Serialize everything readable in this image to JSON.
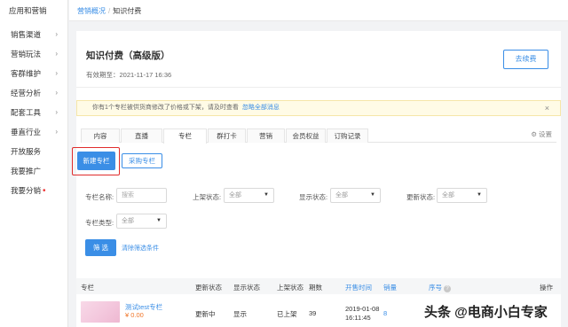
{
  "sidebar": {
    "header": "应用和营销",
    "items": [
      {
        "label": "销售渠道",
        "chevron": true,
        "dot": false
      },
      {
        "label": "营销玩法",
        "chevron": true,
        "dot": false
      },
      {
        "label": "客群维护",
        "chevron": true,
        "dot": false
      },
      {
        "label": "经营分析",
        "chevron": true,
        "dot": false
      },
      {
        "label": "配套工具",
        "chevron": true,
        "dot": false
      },
      {
        "label": "垂直行业",
        "chevron": true,
        "dot": false
      },
      {
        "label": "开放服务",
        "chevron": false,
        "dot": false
      },
      {
        "label": "我要推广",
        "chevron": false,
        "dot": false
      },
      {
        "label": "我要分销",
        "chevron": false,
        "dot": true
      }
    ]
  },
  "breadcrumb": {
    "parent": "营销概况",
    "separator": "/",
    "current": "知识付费"
  },
  "product": {
    "title": "知识付费（高级版）",
    "expiry": "有效期至：2021-11-17 16:36",
    "renew_label": "去续费"
  },
  "notice": {
    "text": "你有1个专栏被供货商修改了价格或下架，请及时查看",
    "link": "忽略全部消息",
    "close": "×"
  },
  "tabs": [
    {
      "label": "内容",
      "active": false
    },
    {
      "label": "直播",
      "active": false
    },
    {
      "label": "专栏",
      "active": true
    },
    {
      "label": "群打卡",
      "active": false
    },
    {
      "label": "营销",
      "active": false
    },
    {
      "label": "会员权益",
      "active": false
    },
    {
      "label": "订购记录",
      "active": false
    }
  ],
  "settings_label": "⚙ 设置",
  "actions": {
    "new_column": "新建专栏",
    "buy_column": "采购专栏"
  },
  "filters": {
    "name_label": "专栏名称:",
    "name_placeholder": "搜索",
    "listing_label": "上架状态:",
    "listing_value": "全部",
    "display_label": "显示状态:",
    "display_value": "全部",
    "update_label": "更新状态:",
    "update_value": "全部",
    "type_label": "专栏类型:",
    "type_value": "全部",
    "filter_button": "筛 选",
    "clear_link": "清除筛选条件"
  },
  "table": {
    "headers": {
      "column": "专栏",
      "update_status": "更新状态",
      "display_status": "显示状态",
      "listing_status": "上架状态",
      "issues": "期数",
      "sell_time": "开售时间",
      "sales": "销量",
      "order_no": "序号",
      "actions": "操作"
    },
    "rows": [
      {
        "name": "测试test专栏",
        "price": "¥ 0.00",
        "update_status": "更新中",
        "display_status": "显示",
        "listing_status": "已上架",
        "issues": "39",
        "sell_date": "2019-01-08",
        "sell_time": "16:11:45",
        "sales": "8"
      }
    ]
  },
  "watermark": "头条 @电商小白专家",
  "colors": {
    "accent": "#3a8ee6",
    "highlight_box": "#e02c2c",
    "notice_bg": "#fffbe6",
    "price": "#f0762a"
  }
}
